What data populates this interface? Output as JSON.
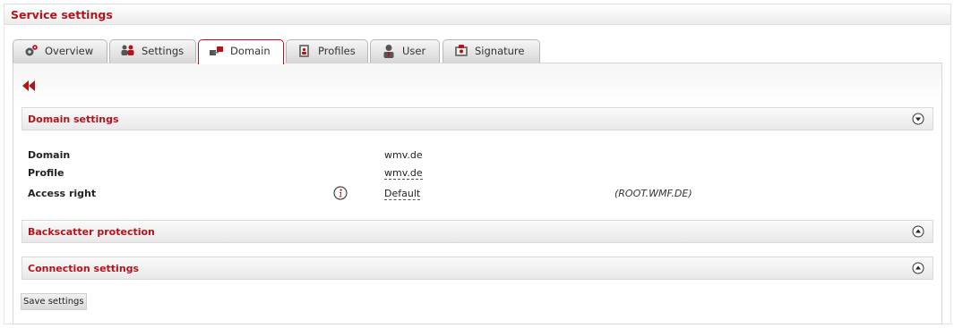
{
  "page": {
    "title": "Service settings"
  },
  "tabs": [
    {
      "label": "Overview",
      "icon": "overview-gear-icon"
    },
    {
      "label": "Settings",
      "icon": "settings-people-icon"
    },
    {
      "label": "Domain",
      "icon": "domain-network-icon",
      "active": true
    },
    {
      "label": "Profiles",
      "icon": "profiles-book-icon"
    },
    {
      "label": "User",
      "icon": "user-icon"
    },
    {
      "label": "Signature",
      "icon": "signature-icon"
    }
  ],
  "sections": {
    "domain": {
      "title": "Domain settings",
      "expanded": true
    },
    "backscatter": {
      "title": "Backscatter protection",
      "expanded": false
    },
    "connection": {
      "title": "Connection settings",
      "expanded": false
    }
  },
  "fields": {
    "domain": {
      "label": "Domain",
      "value": "wmv.de"
    },
    "profile": {
      "label": "Profile",
      "value": "wmv.de"
    },
    "access_right": {
      "label": "Access right",
      "value": "Default",
      "scope": "(ROOT.WMF.DE)"
    }
  },
  "actions": {
    "save_label": "Save settings"
  },
  "colors": {
    "accent": "#b5121b",
    "active_tab_border": "#b5121b"
  }
}
